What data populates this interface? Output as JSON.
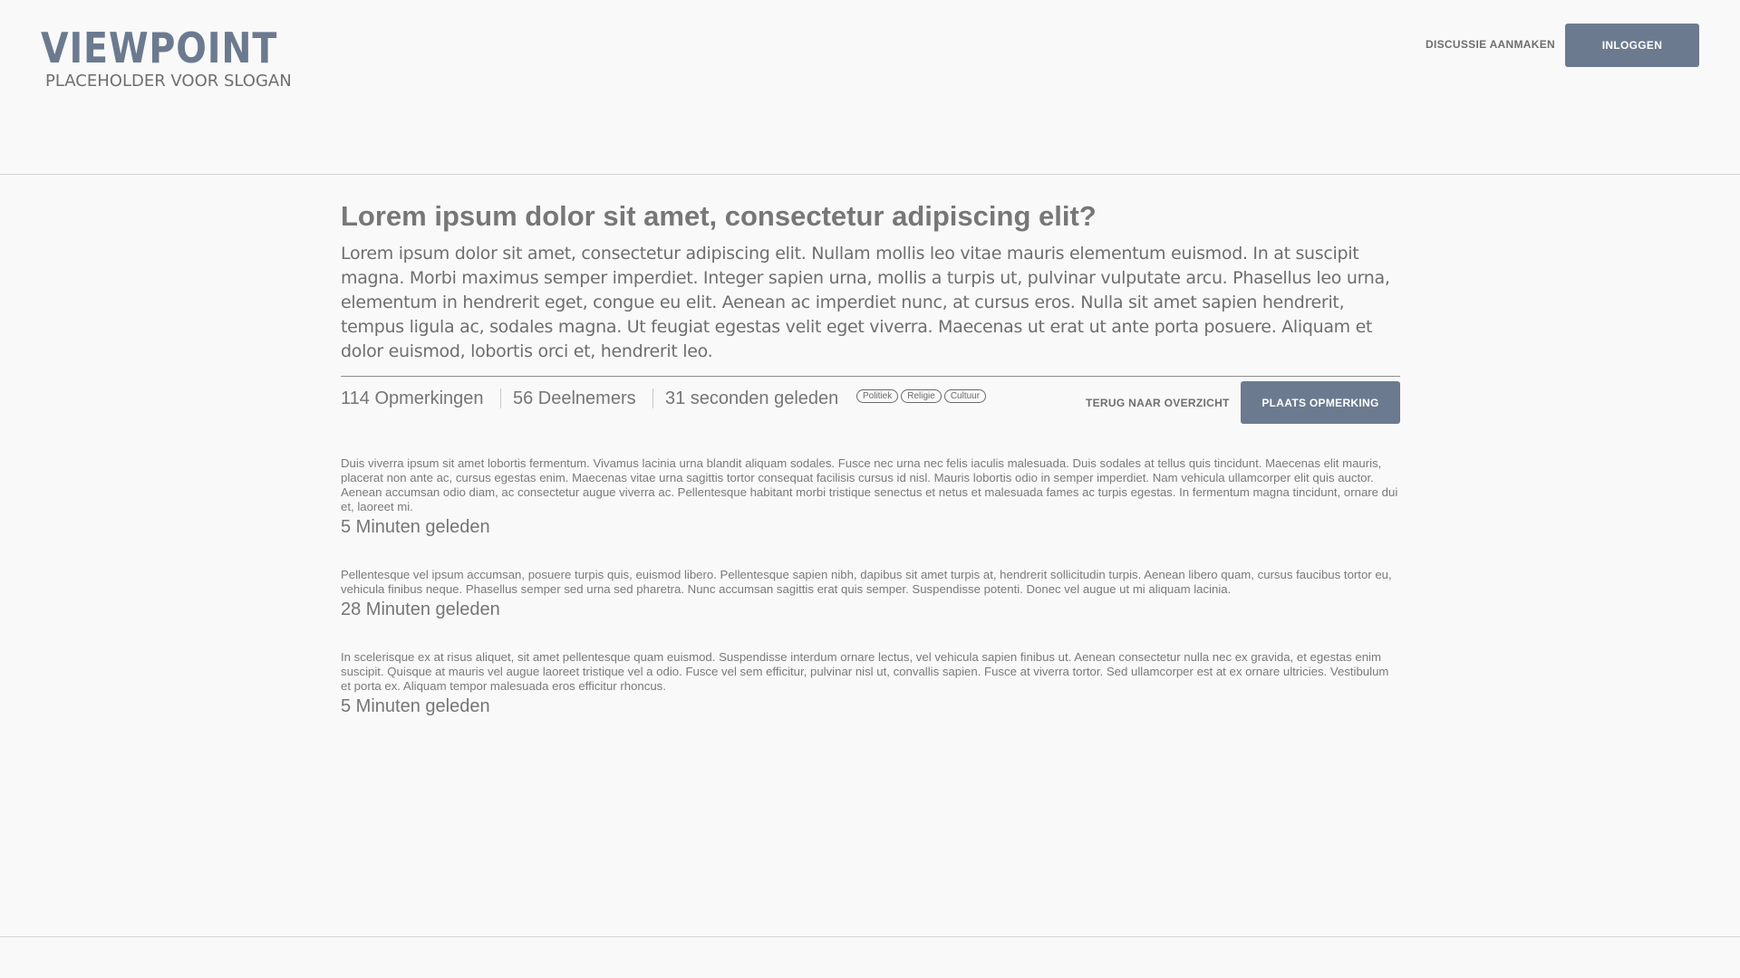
{
  "header": {
    "brand_title": "VIEWPOINT",
    "brand_slogan": "PLACEHOLDER VOOR SLOGAN",
    "create_discussion_label": "DISCUSSIE AANMAKEN",
    "login_label": "INLOGGEN"
  },
  "discussion": {
    "title": "Lorem ipsum dolor sit amet, consectetur adipiscing elit?",
    "body": "Lorem ipsum dolor sit amet, consectetur adipiscing elit. Nullam mollis leo vitae mauris elementum euismod. In at suscipit magna. Morbi maximus semper imperdiet. Integer sapien urna, mollis a turpis ut, pulvinar vulputate arcu. Phasellus leo urna, elementum in hendrerit eget, congue eu elit. Aenean ac imperdiet nunc, at cursus eros. Nulla sit amet sapien hendrerit, tempus ligula ac, sodales magna. Ut feugiat egestas velit eget viverra. Maecenas ut erat ut ante porta posuere. Aliquam et dolor euismod, lobortis orci et, hendrerit leo.",
    "comments_count": "114 Opmerkingen",
    "participants_count": "56 Deelnemers",
    "posted_time": "31 seconden geleden",
    "tags": [
      "Politiek",
      "Religie",
      "Cultuur"
    ],
    "back_label": "TERUG NAAR OVERZICHT",
    "post_comment_label": "PLAATS OPMERKING"
  },
  "comments": [
    {
      "text": "Duis viverra ipsum sit amet lobortis fermentum. Vivamus lacinia urna blandit aliquam sodales. Fusce nec urna nec felis iaculis malesuada. Duis sodales at tellus quis tincidunt. Maecenas elit mauris, placerat non ante ac, cursus egestas enim. Maecenas vitae urna sagittis tortor consequat facilisis cursus id nisl. Mauris lobortis odio in semper imperdiet. Nam vehicula ullamcorper elit quis auctor. Aenean accumsan odio diam, ac consectetur augue viverra ac. Pellentesque habitant morbi tristique senectus et netus et malesuada fames ac turpis egestas. In fermentum magna tincidunt, ornare dui et, laoreet mi.",
      "time": "5 Minuten geleden"
    },
    {
      "text": "Pellentesque vel ipsum accumsan, posuere turpis quis, euismod libero. Pellentesque sapien nibh, dapibus sit amet turpis at, hendrerit sollicitudin turpis. Aenean libero quam, cursus faucibus tortor eu, vehicula finibus neque. Phasellus semper sed urna sed pharetra. Nunc accumsan sagittis erat quis semper. Suspendisse potenti. Donec vel augue ut mi aliquam lacinia.",
      "time": "28 Minuten geleden"
    },
    {
      "text": "In scelerisque ex at risus aliquet, sit amet pellentesque quam euismod. Suspendisse interdum ornare lectus, vel vehicula sapien finibus ut. Aenean consectetur nulla nec ex gravida, et egestas enim suscipit. Quisque at mauris vel augue laoreet tristique vel a odio. Fusce vel sem efficitur, pulvinar nisl ut, convallis sapien. Fusce at viverra tortor. Sed ullamcorper est at ex ornare ultricies. Vestibulum et porta ex. Aliquam tempor malesuada eros efficitur rhoncus.",
      "time": "5 Minuten geleden"
    }
  ]
}
